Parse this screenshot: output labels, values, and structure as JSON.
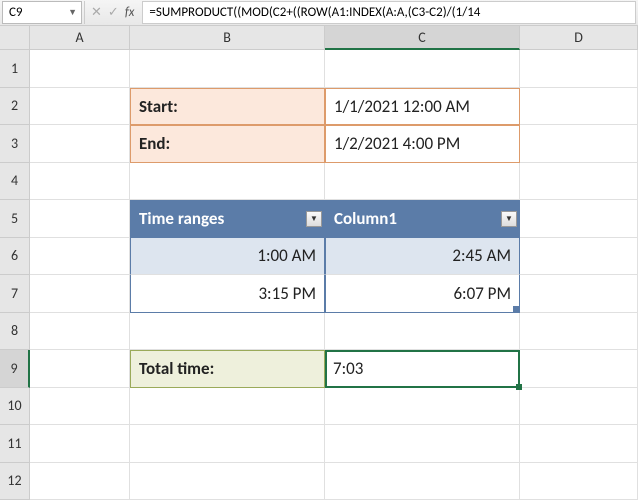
{
  "nameBox": "C9",
  "formula": "=SUMPRODUCT((MOD(C2+((ROW(A1:INDEX(A:A,(C3-C2)/(1/14",
  "columns": [
    "A",
    "B",
    "C",
    "D"
  ],
  "rows": [
    "1",
    "2",
    "3",
    "4",
    "5",
    "6",
    "7",
    "8",
    "9",
    "10",
    "11",
    "12"
  ],
  "labels": {
    "start": "Start:",
    "end": "End:",
    "timeRanges": "Time ranges",
    "column1": "Column1",
    "totalTime": "Total time:"
  },
  "values": {
    "startDate": "1/1/2021 12:00 AM",
    "endDate": "1/2/2021 4:00 PM",
    "range1a": "1:00 AM",
    "range1b": "2:45 AM",
    "range2a": "3:15 PM",
    "range2b": "6:07 PM",
    "total": "7:03"
  }
}
